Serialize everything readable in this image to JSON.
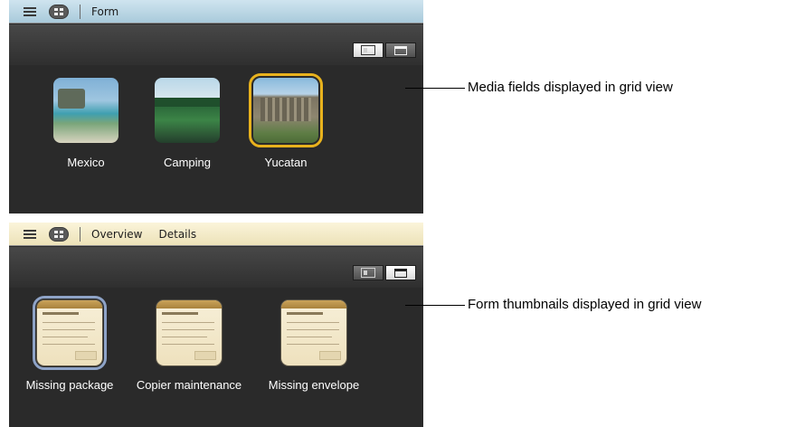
{
  "top_panel": {
    "tabs": [
      "Form"
    ],
    "items": [
      {
        "label": "Mexico",
        "photo": "beach-ruins",
        "selected": false
      },
      {
        "label": "Camping",
        "photo": "forest-lake",
        "selected": false
      },
      {
        "label": "Yucatan",
        "photo": "temple",
        "selected": true
      }
    ],
    "accent": "#e8b21d",
    "tabbar_color": "#b9d6e6"
  },
  "bottom_panel": {
    "tabs": [
      "Overview",
      "Details"
    ],
    "items": [
      {
        "label": "Missing package",
        "selected": true
      },
      {
        "label": "Copier maintenance",
        "selected": false
      },
      {
        "label": "Missing envelope",
        "selected": false
      }
    ],
    "accent": "#8ea3c7",
    "tabbar_color": "#f3ebc9"
  },
  "callouts": {
    "media": "Media fields displayed in grid view",
    "forms": "Form thumbnails displayed in grid view"
  },
  "icons": [
    "list-view-icon",
    "grid-view-icon",
    "split-view-icon",
    "window-view-icon"
  ]
}
